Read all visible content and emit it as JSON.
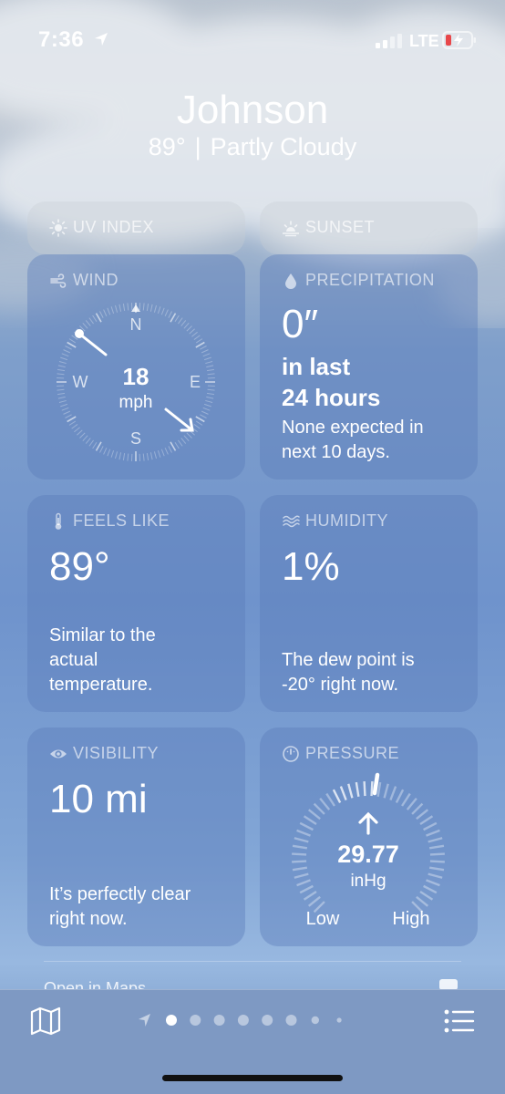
{
  "status_bar": {
    "time": "7:36",
    "network": "LTE"
  },
  "header": {
    "city": "Johnson",
    "temperature": "89°",
    "separator": "|",
    "condition": "Partly Cloudy"
  },
  "cards": {
    "uv_index": {
      "title": "UV INDEX"
    },
    "sunset": {
      "title": "SUNSET"
    },
    "wind": {
      "title": "WIND",
      "speed": "18",
      "unit": "mph",
      "directions": {
        "n": "N",
        "e": "E",
        "s": "S",
        "w": "W"
      },
      "direction_deg": 135
    },
    "precipitation": {
      "title": "PRECIPITATION",
      "amount": "0″",
      "period_line1": "in last",
      "period_line2": "24 hours",
      "desc_line1": "None expected in",
      "desc_line2": "next 10 days."
    },
    "feels_like": {
      "title": "FEELS LIKE",
      "value": "89°",
      "desc_line1": "Similar to the",
      "desc_line2": "actual",
      "desc_line3": "temperature."
    },
    "humidity": {
      "title": "HUMIDITY",
      "value": "1%",
      "desc_line1": "The dew point is",
      "desc_line2": "-20° right now."
    },
    "visibility": {
      "title": "VISIBILITY",
      "value": "10 mi",
      "desc_line1": "It’s perfectly clear",
      "desc_line2": "right now."
    },
    "pressure": {
      "title": "PRESSURE",
      "value": "29.77",
      "unit": "inHg",
      "low_label": "Low",
      "high_label": "High",
      "trend": "rising"
    }
  },
  "peek_text": "Open in Maps",
  "page_indicator": {
    "count": 8,
    "current": 1
  },
  "colors": {
    "card_bg": "#5a7db9",
    "text": "#ffffff"
  }
}
